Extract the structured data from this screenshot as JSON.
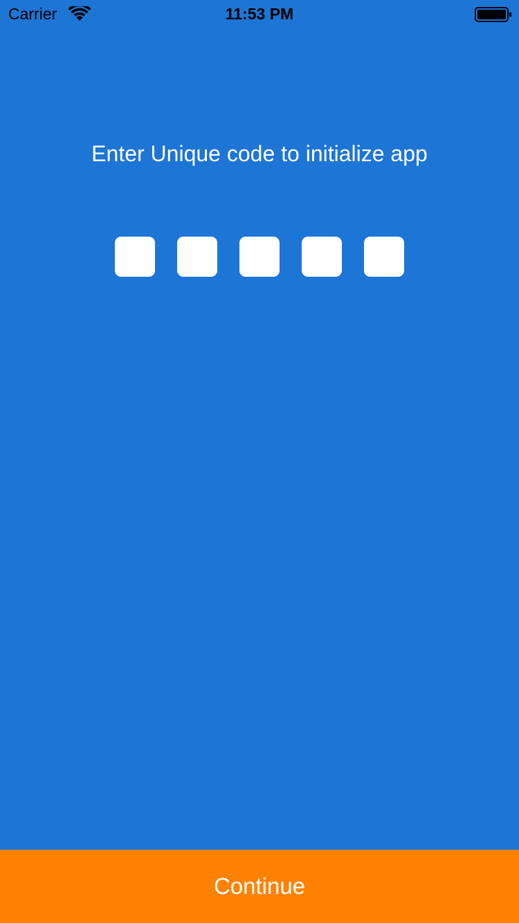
{
  "status_bar": {
    "carrier": "Carrier",
    "time": "11:53 PM",
    "wifi_icon": "wifi-icon",
    "battery_icon": "battery-icon",
    "battery_level": 1.0
  },
  "main": {
    "prompt": "Enter Unique code to initialize app",
    "code_boxes": [
      {
        "value": "",
        "placeholder": ""
      },
      {
        "value": "",
        "placeholder": ""
      },
      {
        "value": "",
        "placeholder": ""
      },
      {
        "value": "",
        "placeholder": ""
      },
      {
        "value": "",
        "placeholder": ""
      }
    ]
  },
  "footer": {
    "continue_label": "Continue"
  },
  "colors": {
    "background": "#1d75d6",
    "button": "#ff8205",
    "text": "#ffffff"
  }
}
